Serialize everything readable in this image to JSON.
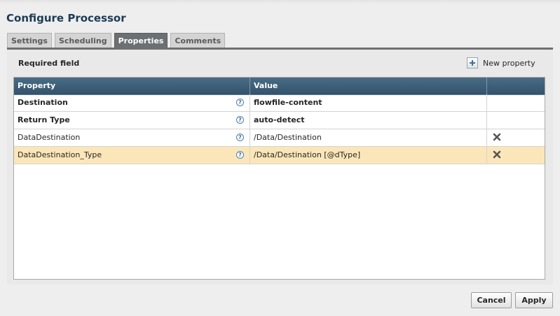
{
  "dialog": {
    "title": "Configure Processor"
  },
  "tabs": [
    {
      "label": "Settings",
      "active": false
    },
    {
      "label": "Scheduling",
      "active": false
    },
    {
      "label": "Properties",
      "active": true
    },
    {
      "label": "Comments",
      "active": false
    }
  ],
  "toolbar": {
    "required_label": "Required field",
    "new_property_label": "New property",
    "new_property_icon": "plus-icon"
  },
  "table": {
    "columns": [
      "Property",
      "Value",
      ""
    ],
    "rows": [
      {
        "property": "Destination",
        "value": "flowfile-content",
        "required": true,
        "removable": false,
        "selected": false
      },
      {
        "property": "Return Type",
        "value": "auto-detect",
        "required": true,
        "removable": false,
        "selected": false
      },
      {
        "property": "DataDestination",
        "value": "/Data/Destination",
        "required": false,
        "removable": true,
        "selected": false
      },
      {
        "property": "DataDestination_Type",
        "value": "/Data/Destination [@dType]",
        "required": false,
        "removable": true,
        "selected": true
      }
    ],
    "help_glyph": "?",
    "help_icon": "help-icon",
    "remove_icon": "close-icon"
  },
  "buttons": {
    "cancel": "Cancel",
    "apply": "Apply"
  },
  "colors": {
    "title": "#1c3b55",
    "header_bg": "#3f6077",
    "active_tab": "#6c7073",
    "selected_row": "#fbe6b9"
  }
}
